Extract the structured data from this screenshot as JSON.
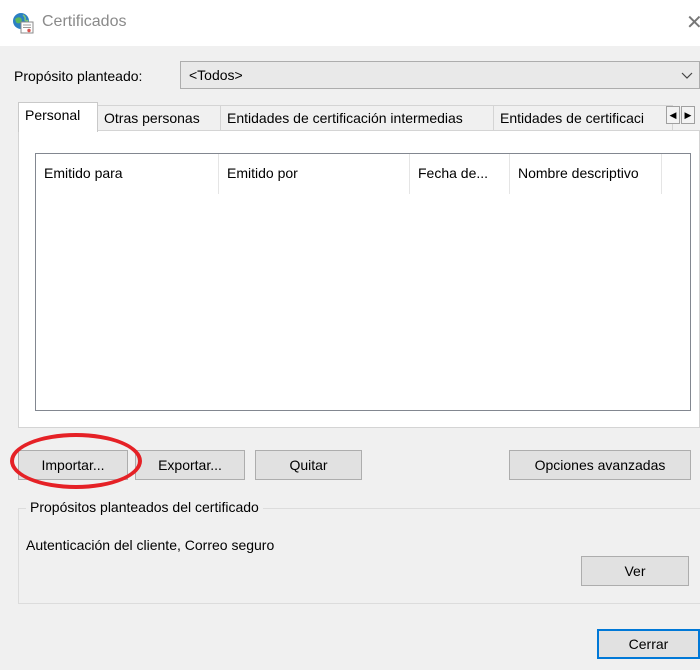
{
  "window": {
    "title": "Certificados",
    "icon": "certificate-globe-icon",
    "close_icon": "close-icon"
  },
  "purpose": {
    "label": "Propósito planteado:",
    "selected": "<Todos>"
  },
  "tabs": [
    {
      "label": "Personal",
      "active": true
    },
    {
      "label": "Otras personas",
      "active": false
    },
    {
      "label": "Entidades de certificación intermedias",
      "active": false
    },
    {
      "label": "Entidades de certificaci",
      "active": false
    }
  ],
  "table": {
    "columns": [
      "Emitido para",
      "Emitido por",
      "Fecha de...",
      "Nombre descriptivo"
    ],
    "rows": []
  },
  "buttons": {
    "import": "Importar...",
    "export": "Exportar...",
    "remove": "Quitar",
    "advanced": "Opciones avanzadas",
    "view": "Ver",
    "close": "Cerrar"
  },
  "cert_purposes": {
    "title": "Propósitos planteados del certificado",
    "text": "Autenticación del cliente, Correo seguro"
  },
  "annotation": {
    "color": "#e52126",
    "target": "import-button"
  }
}
